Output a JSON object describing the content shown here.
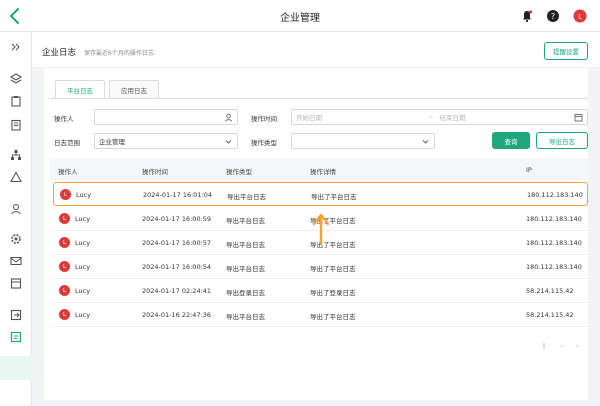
{
  "header": {
    "title": "企业管理"
  },
  "sidebar": {
    "icons": [
      "collapse-icon",
      "layers-icon",
      "clipboard-icon",
      "building-icon",
      "org-chart-icon",
      "triangle-icon",
      "user-icon",
      "gear-icon",
      "mail-icon",
      "calendar-icon",
      "logout-icon",
      "log-icon"
    ]
  },
  "page": {
    "title": "企业日志",
    "subtitle": "保存最近6个月的操作日志",
    "reminder_button": "提醒设置"
  },
  "tabs": [
    {
      "label": "平台日志",
      "active": true
    },
    {
      "label": "应用日志",
      "active": false
    }
  ],
  "filters": {
    "operator_label": "操作人",
    "operator_value": "",
    "time_label": "操作时间",
    "start_placeholder": "开始日期",
    "time_separator": "~",
    "end_placeholder": "结束日期",
    "scope_label": "日志范围",
    "scope_value": "企业管理",
    "type_label": "操作类型",
    "type_value": "",
    "query_button": "查询",
    "export_button": "导出日志"
  },
  "table": {
    "columns": [
      "操作人",
      "操作时间",
      "操作类型",
      "操作详情",
      "IP"
    ],
    "rows": [
      {
        "avatar": "L",
        "user": "Lucy",
        "time": "2024-01-17 16:01:04",
        "type": "导出平台日志",
        "detail": "导出了平台日志",
        "ip": "180.112.183.140",
        "highlighted": true
      },
      {
        "avatar": "L",
        "user": "Lucy",
        "time": "2024-01-17 16:00:59",
        "type": "导出平台日志",
        "detail": "导出了平台日志",
        "ip": "180.112.183.140"
      },
      {
        "avatar": "L",
        "user": "Lucy",
        "time": "2024-01-17 16:00:57",
        "type": "导出平台日志",
        "detail": "导出了平台日志",
        "ip": "180.112.183.140"
      },
      {
        "avatar": "L",
        "user": "Lucy",
        "time": "2024-01-17 16:00:54",
        "type": "导出平台日志",
        "detail": "导出了平台日志",
        "ip": "180.112.183.140"
      },
      {
        "avatar": "L",
        "user": "Lucy",
        "time": "2024-01-17 02:24:41",
        "type": "导出登录日志",
        "detail": "导出了登录日志",
        "ip": "58.214.115.42"
      },
      {
        "avatar": "L",
        "user": "Lucy",
        "time": "2024-01-16 22:47:36",
        "type": "导出平台日志",
        "detail": "导出了平台日志",
        "ip": "58.214.115.42"
      }
    ]
  },
  "pagination": {
    "first": "⟪",
    "prev": "‹",
    "next": "›",
    "last": "⟫"
  },
  "colors": {
    "accent": "#1ea77b",
    "highlight": "#f2a43a",
    "avatar": "#e03a3a"
  }
}
